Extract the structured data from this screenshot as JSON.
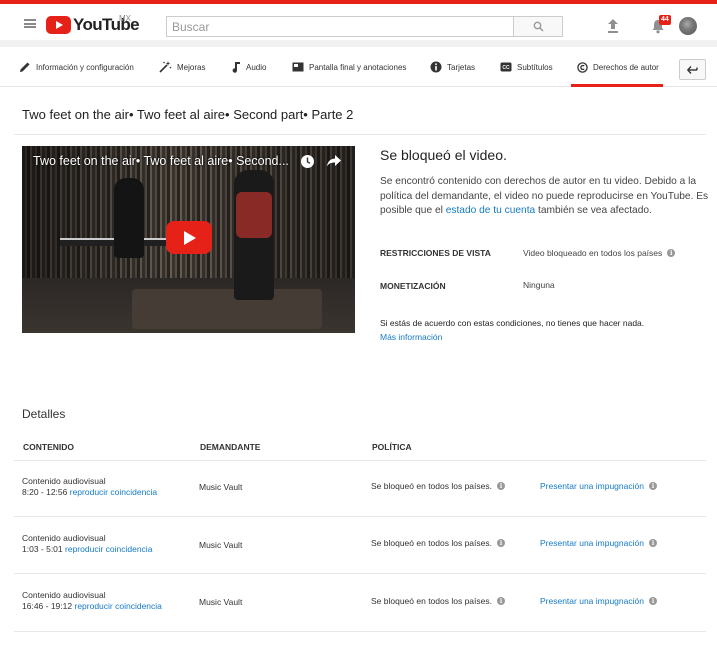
{
  "masthead": {
    "logo_text": "YouTube",
    "country": "MX",
    "search_placeholder": "Buscar",
    "notification_count": "44"
  },
  "tabs": [
    {
      "label": "Información y configuración",
      "icon": "pencil-icon"
    },
    {
      "label": "Mejoras",
      "icon": "magic-wand-icon"
    },
    {
      "label": "Audio",
      "icon": "music-note-icon"
    },
    {
      "label": "Pantalla final y anotaciones",
      "icon": "end-screen-icon"
    },
    {
      "label": "Tarjetas",
      "icon": "info-icon"
    },
    {
      "label": "Subtítulos",
      "icon": "cc-icon"
    },
    {
      "label": "Derechos de autor",
      "icon": "copyright-icon",
      "active": true
    }
  ],
  "video": {
    "title": "Two feet on the air• Two feet al aire• Second part• Parte 2",
    "player_title": "Two feet on the air• Two feet al aire• Second..."
  },
  "status": {
    "heading": "Se bloqueó el video.",
    "desc_part1": "Se encontró contenido con derechos de autor en tu video. Debido a la política del demandante, el video no puede reproducirse en YouTube. Es posible que el ",
    "desc_link": "estado de tu cuenta",
    "desc_part2": " también se vea afectado.",
    "restrictions_label": "RESTRICCIONES DE VISTA",
    "restrictions_value": "Video bloqueado en todos los países",
    "monetization_label": "MONETIZACIÓN",
    "monetization_value": "Ninguna",
    "notice": "Si estás de acuerdo con estas condiciones, no tienes que hacer nada.",
    "more_info": "Más información"
  },
  "details": {
    "heading": "Detalles",
    "columns": {
      "content": "CONTENIDO",
      "claimant": "DEMANDANTE",
      "policy": "POLÍTICA"
    },
    "rows": [
      {
        "type": "Contenido audiovisual",
        "range": "8:20 - 12:56",
        "play": "reproducir coincidencia",
        "claimant": "Music Vault",
        "policy": "Se bloqueó en todos los países.",
        "dispute": "Presentar una impugnación"
      },
      {
        "type": "Contenido audiovisual",
        "range": "1:03 - 5:01",
        "play": "reproducir coincidencia",
        "claimant": "Music Vault",
        "policy": "Se bloqueó en todos los países.",
        "dispute": "Presentar una impugnación"
      },
      {
        "type": "Contenido audiovisual",
        "range": "16:46 - 19:12",
        "play": "reproducir coincidencia",
        "claimant": "Music Vault",
        "policy": "Se bloqueó en todos los países.",
        "dispute": "Presentar una impugnación"
      }
    ]
  },
  "colors": {
    "brand_red": "#e62117",
    "link_blue": "#167ac6"
  }
}
